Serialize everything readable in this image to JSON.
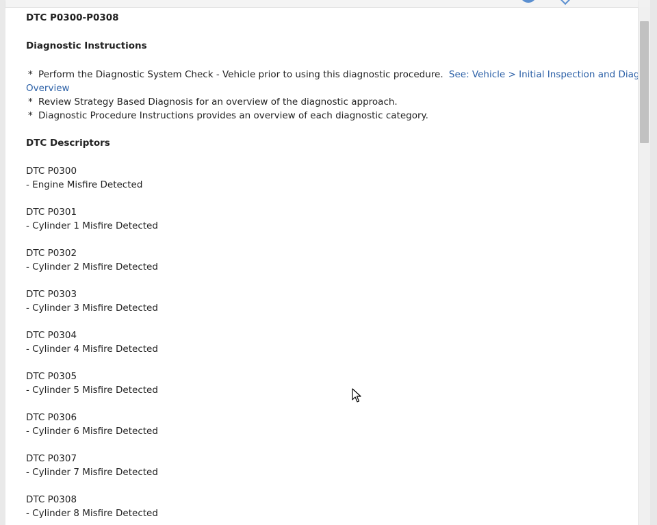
{
  "document": {
    "title": "DTC P0300-P0308",
    "instructions_heading": "Diagnostic Instructions",
    "instructions": [
      {
        "bullet": "*",
        "text": "Perform the Diagnostic System Check - Vehicle prior to using this diagnostic procedure.",
        "link_text": "See: Vehicle > Initial Inspection and Diagnostic",
        "link_text_cont": "Overview"
      },
      {
        "bullet": "*",
        "text": "Review Strategy Based Diagnosis for an overview of the diagnostic approach."
      },
      {
        "bullet": "*",
        "text": "Diagnostic Procedure Instructions provides an overview of each diagnostic category."
      }
    ],
    "descriptors_heading": "DTC Descriptors",
    "descriptors": [
      {
        "code": "DTC P0300",
        "desc": "-  Engine Misfire Detected"
      },
      {
        "code": "DTC P0301",
        "desc": "-  Cylinder 1 Misfire Detected"
      },
      {
        "code": "DTC P0302",
        "desc": "-  Cylinder 2 Misfire Detected"
      },
      {
        "code": "DTC P0303",
        "desc": "-  Cylinder 3 Misfire Detected"
      },
      {
        "code": "DTC P0304",
        "desc": "-  Cylinder 4 Misfire Detected"
      },
      {
        "code": "DTC P0305",
        "desc": "-  Cylinder 5 Misfire Detected"
      },
      {
        "code": "DTC P0306",
        "desc": "-  Cylinder 6 Misfire Detected"
      },
      {
        "code": "DTC P0307",
        "desc": "-  Cylinder 7 Misfire Detected"
      },
      {
        "code": "DTC P0308",
        "desc": "-  Cylinder 8 Misfire Detected"
      }
    ]
  },
  "colors": {
    "text": "#222222",
    "link": "#2a5fa6",
    "background": "#ffffff"
  },
  "icons": {
    "top_avatar": "user-avatar-icon",
    "top_chevron": "chevron-down-icon",
    "cursor": "mouse-pointer-icon"
  }
}
